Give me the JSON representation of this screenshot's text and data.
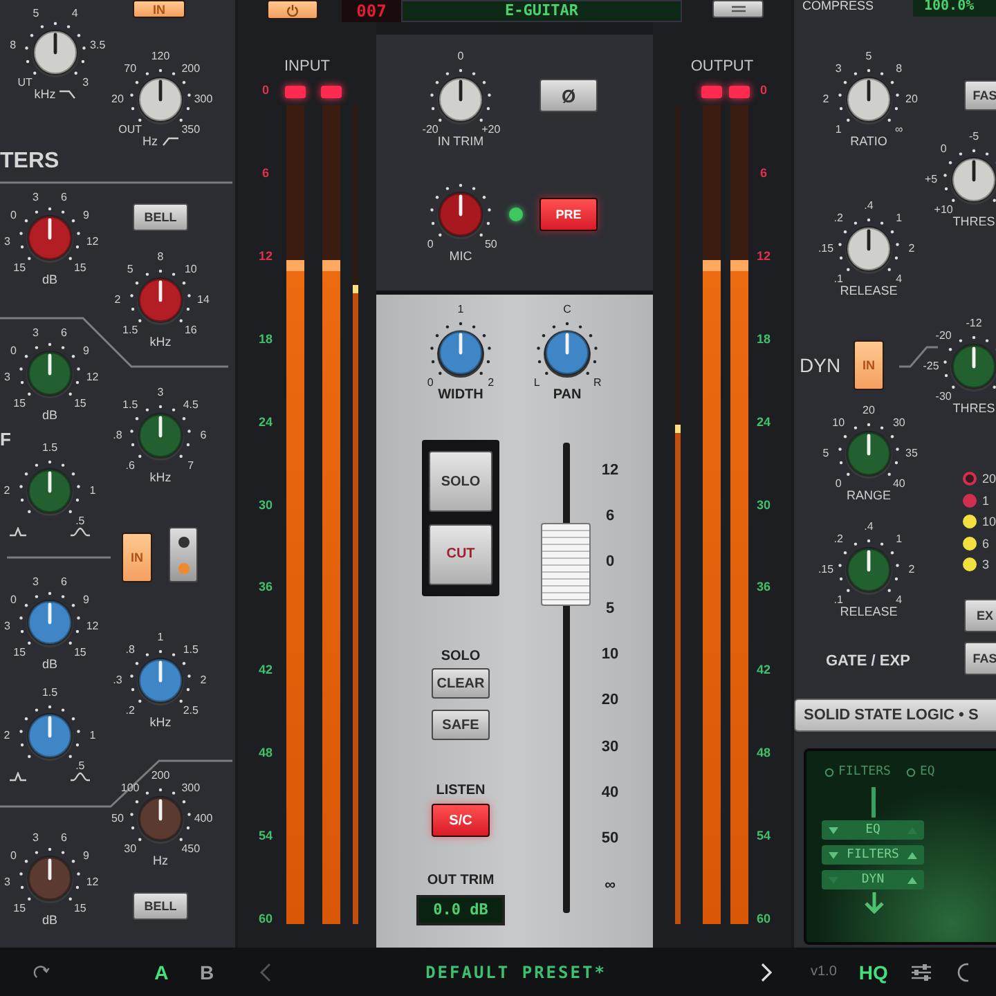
{
  "top_bar": {
    "eq_in_button": {
      "label": "IN",
      "on": true
    },
    "power_button": {
      "on": true
    },
    "preset_number": "007",
    "preset_name": "E-GUITAR",
    "compressor_label": "COMPRESS",
    "mix_display": "100.0%"
  },
  "eq_panel": {
    "section_label": "TERS",
    "band_label": "F",
    "knobs": [
      {
        "color": "#cfcfcc",
        "scale": [
          "UT",
          "8",
          "5",
          "4",
          "3.5",
          "3"
        ],
        "unit": "kHz",
        "kind": "lowpass"
      },
      {
        "color": "#cfcfcc",
        "scale": [
          "OUT",
          "20",
          "70",
          "120",
          "200",
          "300",
          "350"
        ],
        "unit": "Hz",
        "kind": "highpass"
      },
      {
        "color": "#b31d24",
        "scale": [
          "15",
          "3",
          "0",
          "3",
          "6",
          "9",
          "12",
          "15"
        ],
        "unit": "dB"
      },
      {
        "color": "#b31d24",
        "scale": [
          "1.5",
          "2",
          "5",
          "8",
          "10",
          "14",
          "16"
        ],
        "unit": "kHz"
      },
      {
        "color": "#22602f",
        "scale": [
          "15",
          "3",
          "0",
          "3",
          "6",
          "9",
          "12",
          "15"
        ],
        "unit": "dB"
      },
      {
        "color": "#22602f",
        "scale": [
          ".6",
          ".8",
          "1.5",
          "3",
          "4.5",
          "6",
          "7"
        ],
        "unit": "kHz"
      },
      {
        "color": "#22602f",
        "scale": [
          "1.5",
          "2",
          "1",
          ".5"
        ],
        "kind": "q"
      },
      {
        "color": "#3e86c6",
        "scale": [
          "15",
          "3",
          "0",
          "3",
          "6",
          "9",
          "12",
          "15"
        ],
        "unit": "dB"
      },
      {
        "color": "#3e86c6",
        "scale": [
          ".2",
          ".3",
          ".8",
          "1",
          "1.5",
          "2",
          "2.5"
        ],
        "unit": "kHz"
      },
      {
        "color": "#3e86c6",
        "scale": [
          "1.5",
          "2",
          "1",
          ".5"
        ],
        "kind": "q"
      },
      {
        "color": "#5b3a32",
        "scale": [
          "30",
          "50",
          "100",
          "200",
          "300",
          "400",
          "450"
        ],
        "unit": "Hz"
      },
      {
        "color": "#5b3a32",
        "scale": [
          "15",
          "3",
          "0",
          "3",
          "6",
          "9",
          "12",
          "15"
        ],
        "unit": "dB"
      }
    ],
    "buttons": [
      {
        "label": "BELL"
      },
      {
        "label": "BELL"
      }
    ],
    "band_in_button": {
      "label": "IN",
      "on": true
    },
    "band_toggle": {
      "selected_lower": true
    }
  },
  "input_meter": {
    "label": "INPUT",
    "scale": [
      {
        "text": "0",
        "color": "#e0304e"
      },
      {
        "text": "6",
        "color": "#e0304e"
      },
      {
        "text": "12",
        "color": "#e0304e"
      },
      {
        "text": "18",
        "color": "#3fc06a"
      },
      {
        "text": "24",
        "color": "#3fc06a"
      },
      {
        "text": "30",
        "color": "#3fc06a"
      },
      {
        "text": "36",
        "color": "#3fc06a"
      },
      {
        "text": "42",
        "color": "#3fc06a"
      },
      {
        "text": "48",
        "color": "#3fc06a"
      },
      {
        "text": "54",
        "color": "#3fc06a"
      },
      {
        "text": "60",
        "color": "#3fc06a"
      }
    ],
    "bars": [
      {
        "level": 0.81,
        "clip": true
      },
      {
        "level": 0.81,
        "clip": true
      }
    ],
    "peak": {
      "level": 0.78
    }
  },
  "channel": {
    "knobs": [
      {
        "color": "#d0d0cd",
        "scale": [
          "-20",
          "0",
          "+20"
        ],
        "unit": "IN TRIM"
      },
      {
        "color": "#a8181f",
        "scale": [
          "0",
          "50"
        ],
        "unit": "MIC"
      },
      {
        "color": "#3e86c6",
        "scale": [
          "0",
          "1",
          "2"
        ],
        "unit": "WIDTH"
      },
      {
        "color": "#3e86c6",
        "scale": [
          "L",
          "C",
          "R"
        ],
        "unit": "PAN"
      }
    ],
    "phase_button": {
      "label": "Ø",
      "on": false
    },
    "signal_led": {
      "on": true
    },
    "pre_button": {
      "label": "PRE",
      "on": true
    },
    "solo_button": {
      "label": "SOLO",
      "on": false
    },
    "cut_button": {
      "label": "CUT",
      "on": false
    },
    "fader": {
      "level": 0.74,
      "scale": [
        "12",
        "6",
        "0",
        "5",
        "10",
        "20",
        "30",
        "40",
        "50",
        "∞"
      ]
    },
    "solo_label": "SOLO",
    "clear_button": {
      "label": "CLEAR"
    },
    "safe_button": {
      "label": "SAFE"
    },
    "listen_label": "LISTEN",
    "sc_button": {
      "label": "S/C",
      "on": true
    },
    "out_trim_label": "OUT TRIM",
    "out_trim_display": "0.0 dB"
  },
  "output_meter": {
    "label": "OUTPUT",
    "scale": [
      {
        "text": "0",
        "color": "#e0304e"
      },
      {
        "text": "6",
        "color": "#e0304e"
      },
      {
        "text": "12",
        "color": "#e0304e"
      },
      {
        "text": "18",
        "color": "#3fc06a"
      },
      {
        "text": "24",
        "color": "#3fc06a"
      },
      {
        "text": "30",
        "color": "#3fc06a"
      },
      {
        "text": "36",
        "color": "#3fc06a"
      },
      {
        "text": "42",
        "color": "#3fc06a"
      },
      {
        "text": "48",
        "color": "#3fc06a"
      },
      {
        "text": "54",
        "color": "#3fc06a"
      },
      {
        "text": "60",
        "color": "#3fc06a"
      }
    ],
    "bars": [
      {
        "level": 0.81,
        "clip": true
      },
      {
        "level": 0.81,
        "clip": true
      }
    ],
    "peak": {
      "level": 0.61
    }
  },
  "dynamics_panel": {
    "knobs": [
      {
        "color": "#cfcfcc",
        "scale": [
          "1",
          "2",
          "3",
          "5",
          "8",
          "20",
          "∞"
        ],
        "unit": "RATIO"
      },
      {
        "color": "#cfcfcc",
        "scale": [
          "+10",
          "+5",
          "0",
          "-5"
        ],
        "unit": "THRES"
      },
      {
        "color": "#cfcfcc",
        "scale": [
          ".1",
          ".15",
          ".2",
          ".4",
          "1",
          "2",
          "4"
        ],
        "unit": "RELEASE"
      },
      {
        "color": "#22602f",
        "scale": [
          "-30",
          "-25",
          "-20",
          "-12"
        ],
        "unit": "THRES"
      },
      {
        "color": "#22602f",
        "scale": [
          "0",
          "5",
          "10",
          "20",
          "30",
          "35",
          "40"
        ],
        "unit": "RANGE"
      },
      {
        "color": "#22602f",
        "scale": [
          ".1",
          ".15",
          ".2",
          ".4",
          "1",
          "2",
          "4"
        ],
        "unit": "RELEASE"
      }
    ],
    "comp_fast_button": {
      "label": "FAS"
    },
    "dyn_label": "DYN",
    "dyn_in_button": {
      "label": "IN",
      "on": true
    },
    "gate_leds": [
      {
        "label": "20",
        "on": false,
        "color": "#d0304e"
      },
      {
        "label": "1",
        "on": true,
        "color": "#d0304e"
      },
      {
        "label": "10",
        "on": true,
        "color": "#f2e040"
      },
      {
        "label": "6",
        "on": true,
        "color": "#f2e040"
      },
      {
        "label": "3",
        "on": true,
        "color": "#f2e040"
      }
    ],
    "expander_button": {
      "label": "EX"
    },
    "gate_fast_button": {
      "label": "FAS"
    },
    "gate_label": "GATE / EXP",
    "brand_plate": "SOLID STATE LOGIC • S",
    "routing_screen": {
      "tabs": [
        {
          "label": "FILTERS"
        },
        {
          "label": "EQ"
        }
      ],
      "rows": [
        {
          "label": "EQ",
          "down": true,
          "up": false
        },
        {
          "label": "FILTERS",
          "down": true,
          "up": true
        },
        {
          "label": "DYN",
          "down": false,
          "up": true
        }
      ]
    }
  },
  "bottom_bar": {
    "compare_a": {
      "label": "A",
      "selected": true
    },
    "compare_b": {
      "label": "B",
      "selected": false
    },
    "preset_name": "DEFAULT PRESET*",
    "version": "v1.0",
    "quality_button": {
      "label": "HQ",
      "on": true
    }
  }
}
